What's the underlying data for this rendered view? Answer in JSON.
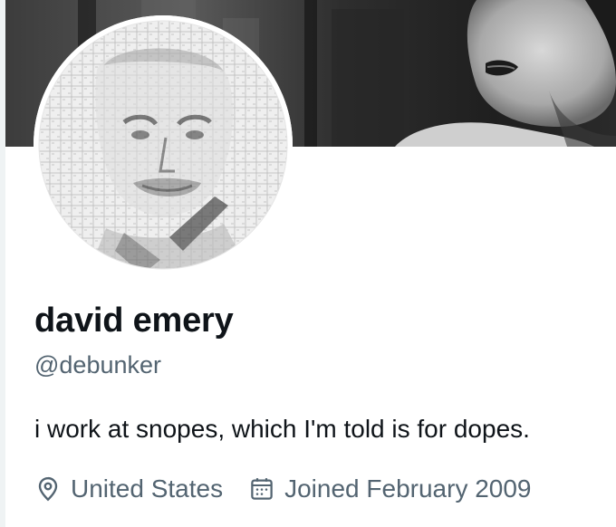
{
  "profile": {
    "display_name": "david emery",
    "handle": "@debunker",
    "bio": "i work at snopes, which I'm told is for dopes.",
    "location": "United States",
    "joined": "Joined February 2009"
  },
  "icons": {
    "location": "location-pin-icon",
    "joined": "calendar-icon"
  },
  "colors": {
    "text_primary": "#0f1419",
    "text_secondary": "#536471",
    "background": "#ffffff"
  }
}
